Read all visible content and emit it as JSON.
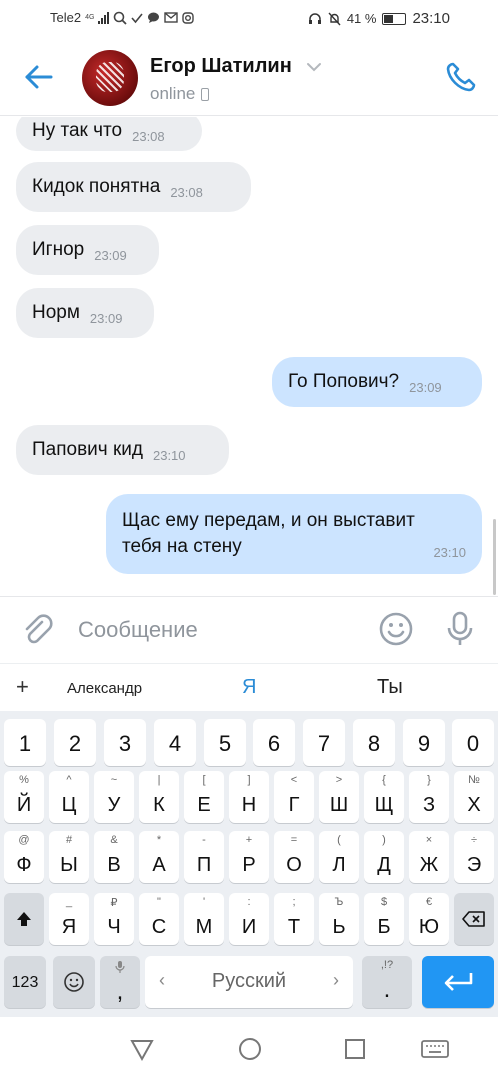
{
  "status_bar": {
    "carrier": "Tele2",
    "network": "4G",
    "battery": "41 %",
    "time": "23:10"
  },
  "header": {
    "name": "Егор Шатилин",
    "status": "online"
  },
  "messages": [
    {
      "dir": "in",
      "text": "Ну так что",
      "time": "23:08"
    },
    {
      "dir": "in",
      "text": "Кидок понятна",
      "time": "23:08"
    },
    {
      "dir": "in",
      "text": "Игнор",
      "time": "23:09"
    },
    {
      "dir": "in",
      "text": "Норм",
      "time": "23:09"
    },
    {
      "dir": "out",
      "text": "Го Попович?",
      "time": "23:09"
    },
    {
      "dir": "in",
      "text": "Папович кид",
      "time": "23:10"
    },
    {
      "dir": "out",
      "text": "Щас ему передам, и он выставит тебя на стену",
      "line1": "Щас ему передам, и он выставит",
      "line2": "тебя на стену",
      "time": "23:10"
    }
  ],
  "composer": {
    "placeholder": "Сообщение"
  },
  "suggestions": {
    "plus": "+",
    "items": [
      "Александр",
      "Я",
      "Ты"
    ]
  },
  "keyboard": {
    "numbers": [
      "1",
      "2",
      "3",
      "4",
      "5",
      "6",
      "7",
      "8",
      "9",
      "0"
    ],
    "row1": {
      "keys": [
        "Й",
        "Ц",
        "У",
        "К",
        "Е",
        "Н",
        "Г",
        "Ш",
        "Щ",
        "З",
        "Х"
      ],
      "alts": [
        "%",
        "^",
        "~",
        "|",
        "[",
        "]",
        "<",
        ">",
        "{",
        "}",
        "№"
      ]
    },
    "row2": {
      "keys": [
        "Ф",
        "Ы",
        "В",
        "А",
        "П",
        "Р",
        "О",
        "Л",
        "Д",
        "Ж",
        "Э"
      ],
      "alts": [
        "@",
        "#",
        "&",
        "*",
        "-",
        "+",
        "=",
        "(",
        ")",
        "×",
        "÷"
      ]
    },
    "row3": {
      "keys": [
        "Я",
        "Ч",
        "С",
        "М",
        "И",
        "Т",
        "Ь",
        "Б",
        "Ю"
      ],
      "alts": [
        "_",
        "₽",
        "\"",
        "'",
        ":",
        ";",
        "Ъ",
        "$",
        "€"
      ]
    },
    "numbers_key": "123",
    "comma": ",",
    "space_label": "Русский",
    "period": ".",
    "period_alt": ",!?"
  },
  "colors": {
    "accent": "#2b8cd6",
    "outgoing_bubble": "#cce4ff",
    "incoming_bubble": "#ebedf0",
    "enter_key": "#2196f3"
  }
}
